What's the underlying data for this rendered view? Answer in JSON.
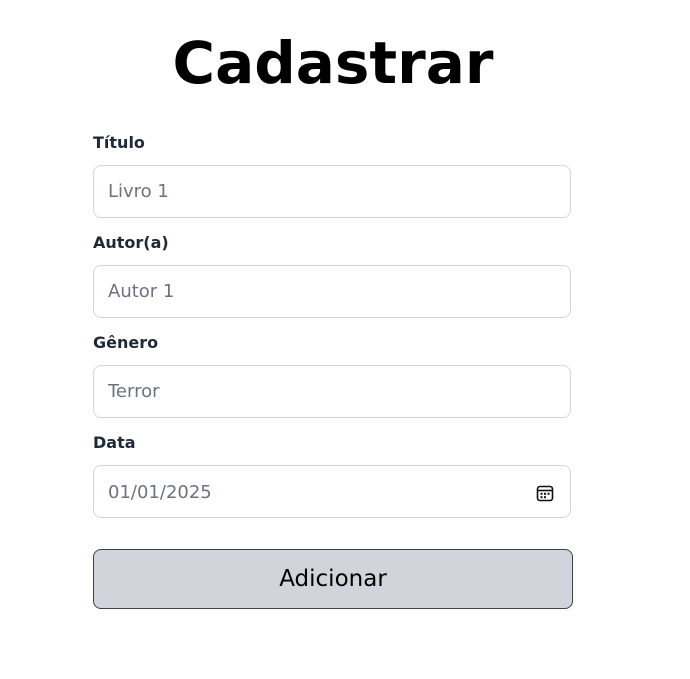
{
  "page": {
    "title": "Cadastrar"
  },
  "form": {
    "fields": [
      {
        "label": "Título",
        "placeholder": "Livro 1"
      },
      {
        "label": "Autor(a)",
        "placeholder": "Autor 1"
      },
      {
        "label": "Gênero",
        "placeholder": "Terror"
      },
      {
        "label": "Data",
        "value": "01/01/2025",
        "icon": "calendar-icon"
      }
    ],
    "submit_label": "Adicionar"
  },
  "colors": {
    "label": "#1f2937",
    "input_border": "#d1d5db",
    "placeholder": "#6b7280",
    "button_bg": "#d1d5db",
    "button_border": "#374151"
  }
}
